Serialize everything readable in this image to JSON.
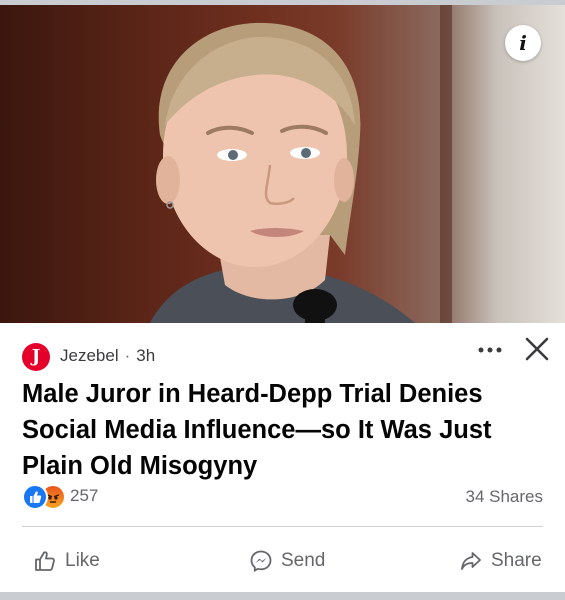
{
  "post": {
    "source_name": "Jezebel",
    "source_initial": "J",
    "time_ago": "3h",
    "headline": "Male Juror in Heard-Depp Trial Denies Social Media Influence—so It Was Just Plain Old Misogyny",
    "reactions": {
      "icons": [
        "like-reaction-icon",
        "angry-reaction-icon"
      ],
      "count": "257"
    },
    "shares": "34 Shares"
  },
  "actions": {
    "like": "Like",
    "send": "Send",
    "share": "Share"
  },
  "colors": {
    "brand_logo": "#e4002b",
    "like_blue": "#1877f2",
    "text_secondary": "#65676b",
    "headline": "#050505"
  }
}
